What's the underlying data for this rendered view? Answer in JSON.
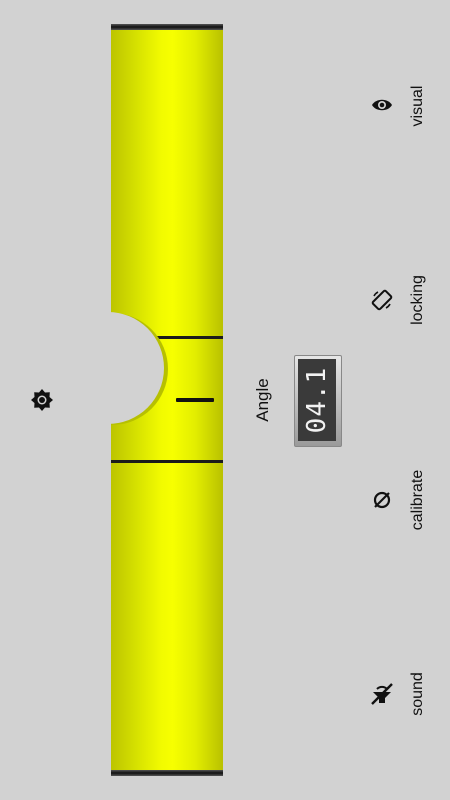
{
  "level": {
    "angle_label": "Angle",
    "angle_value": "04.1"
  },
  "controls": {
    "brightness": {
      "icon": "brightness-icon"
    },
    "visual": {
      "label": "visual",
      "icon": "eye-icon"
    },
    "locking": {
      "label": "locking",
      "icon": "rotation-lock-icon"
    },
    "calibrate": {
      "label": "calibrate",
      "icon": "calibrate-icon"
    },
    "sound": {
      "label": "sound",
      "icon": "sound-off-icon"
    }
  },
  "colors": {
    "tube": "#f2fb00",
    "background": "#d2d2d2",
    "display_bg": "#3a3a3a"
  }
}
